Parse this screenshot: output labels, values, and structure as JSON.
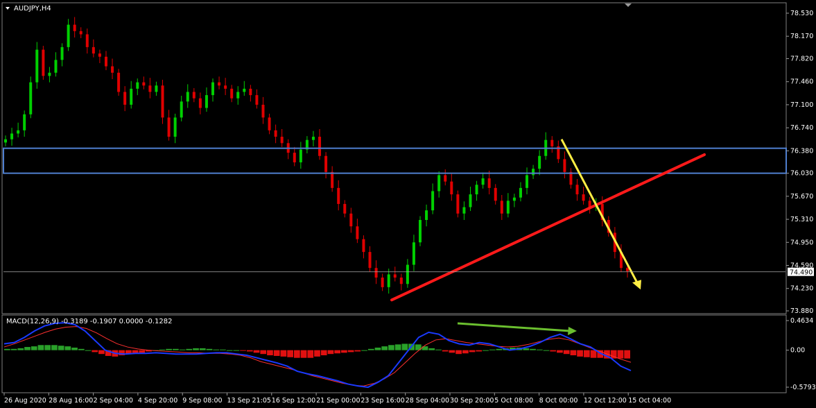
{
  "symbol_label": "AUDJPY,H4",
  "chart_data": [
    {
      "type": "candlestick",
      "title": "AUDJPY,H4",
      "y_ticks": [
        "78.530",
        "78.170",
        "77.820",
        "77.460",
        "77.100",
        "76.740",
        "76.380",
        "76.030",
        "75.670",
        "75.310",
        "74.950",
        "74.590",
        "74.230",
        "73.880"
      ],
      "ylim": [
        73.88,
        78.53
      ],
      "current_price": "74.490",
      "x_labels": [
        "26 Aug 2020",
        "28 Aug 16:00",
        "2 Sep 04:00",
        "4 Sep 20:00",
        "9 Sep 08:00",
        "13 Sep 21:05",
        "16 Sep 12:00",
        "21 Sep 00:00",
        "23 Sep 16:00",
        "28 Sep 04:00",
        "30 Sep 20:00",
        "5 Oct 08:00",
        "8 Oct 00:00",
        "12 Oct 12:00",
        "15 Oct 04:00"
      ],
      "closes": [
        76.56,
        76.65,
        76.7,
        76.95,
        77.45,
        77.96,
        77.55,
        77.6,
        77.8,
        78.0,
        78.35,
        78.25,
        78.2,
        78.0,
        77.9,
        77.85,
        77.7,
        77.6,
        77.3,
        77.1,
        77.35,
        77.45,
        77.4,
        77.3,
        77.4,
        76.9,
        76.6,
        76.9,
        77.15,
        77.3,
        77.2,
        77.05,
        77.25,
        77.45,
        77.4,
        77.35,
        77.2,
        77.3,
        77.35,
        77.25,
        77.1,
        76.9,
        76.7,
        76.6,
        76.5,
        76.35,
        76.2,
        76.4,
        76.55,
        76.6,
        76.3,
        76.05,
        75.8,
        75.55,
        75.4,
        75.2,
        75.0,
        74.8,
        74.55,
        74.4,
        74.25,
        74.45,
        74.4,
        74.3,
        74.6,
        74.95,
        75.3,
        75.45,
        75.75,
        76.0,
        75.9,
        75.7,
        75.4,
        75.5,
        75.7,
        75.85,
        75.95,
        75.8,
        75.6,
        75.4,
        75.6,
        75.65,
        75.8,
        76.0,
        76.1,
        76.3,
        76.55,
        76.45,
        76.25,
        76.05,
        75.85,
        75.7,
        75.6,
        75.5,
        75.55,
        75.3,
        75.1,
        74.8,
        74.55,
        74.5
      ],
      "support_zone": [
        76.03,
        76.42
      ],
      "trendline_red": [
        [
          74.05
        ],
        [
          76.32
        ]
      ],
      "trendline_yellow": [
        [
          76.56
        ],
        [
          74.3
        ]
      ]
    },
    {
      "type": "histogram+line",
      "title": "MACD(12,26,9) -0.3189 -0.1907 0.0000 -0.1282",
      "y_ticks": [
        "0.4634",
        "0.00",
        "-0.5793"
      ],
      "ylim": [
        -0.5793,
        0.4634
      ],
      "histogram": [
        0.02,
        0.02,
        0.03,
        0.05,
        0.06,
        0.08,
        0.08,
        0.08,
        0.07,
        0.06,
        0.04,
        0.02,
        0.0,
        -0.03,
        -0.06,
        -0.09,
        -0.1,
        -0.08,
        -0.06,
        -0.05,
        -0.04,
        -0.02,
        0.0,
        0.01,
        0.02,
        0.02,
        0.01,
        0.02,
        0.03,
        0.03,
        0.02,
        0.01,
        0.01,
        0.0,
        0.0,
        -0.01,
        -0.02,
        -0.04,
        -0.06,
        -0.08,
        -0.09,
        -0.1,
        -0.11,
        -0.12,
        -0.12,
        -0.12,
        -0.1,
        -0.08,
        -0.06,
        -0.05,
        -0.04,
        -0.03,
        -0.02,
        0.0,
        0.02,
        0.04,
        0.06,
        0.08,
        0.09,
        0.1,
        0.1,
        0.09,
        0.06,
        0.03,
        0.01,
        -0.02,
        -0.04,
        -0.06,
        -0.05,
        -0.03,
        -0.02,
        0.0,
        0.01,
        0.02,
        0.03,
        0.04,
        0.04,
        0.03,
        0.02,
        0.01,
        0.0,
        -0.02,
        -0.04,
        -0.06,
        -0.08,
        -0.1,
        -0.11,
        -0.12,
        -0.12,
        -0.13,
        -0.13,
        -0.13,
        -0.13
      ],
      "macd_line": [
        0.1,
        0.12,
        0.2,
        0.3,
        0.38,
        0.42,
        0.43,
        0.4,
        0.3,
        0.15,
        0.0,
        -0.05,
        -0.06,
        -0.05,
        -0.05,
        -0.04,
        -0.05,
        -0.06,
        -0.06,
        -0.06,
        -0.05,
        -0.04,
        -0.04,
        -0.06,
        -0.08,
        -0.12,
        -0.16,
        -0.2,
        -0.25,
        -0.33,
        -0.37,
        -0.4,
        -0.44,
        -0.48,
        -0.53,
        -0.56,
        -0.58,
        -0.5,
        -0.4,
        -0.2,
        0.0,
        0.2,
        0.28,
        0.25,
        0.15,
        0.1,
        0.08,
        0.12,
        0.1,
        0.05,
        0.0,
        0.02,
        0.06,
        0.12,
        0.2,
        0.25,
        0.18,
        0.1,
        0.05,
        -0.05,
        -0.12,
        -0.25,
        -0.32
      ],
      "signal_line": [
        0.05,
        0.1,
        0.16,
        0.22,
        0.28,
        0.33,
        0.36,
        0.37,
        0.34,
        0.27,
        0.18,
        0.1,
        0.05,
        0.02,
        0.0,
        -0.01,
        -0.02,
        -0.03,
        -0.04,
        -0.04,
        -0.05,
        -0.05,
        -0.06,
        -0.08,
        -0.12,
        -0.18,
        -0.22,
        -0.26,
        -0.3,
        -0.35,
        -0.4,
        -0.44,
        -0.48,
        -0.52,
        -0.55,
        -0.56,
        -0.52,
        -0.45,
        -0.35,
        -0.2,
        -0.05,
        0.08,
        0.16,
        0.18,
        0.15,
        0.12,
        0.1,
        0.08,
        0.06,
        0.05,
        0.06,
        0.09,
        0.13,
        0.17,
        0.19,
        0.16,
        0.1,
        0.04,
        -0.02,
        -0.08,
        -0.14,
        -0.19
      ],
      "divergence_arrow": "green"
    }
  ],
  "colors": {
    "bull": "#00d000",
    "bear": "#e00000",
    "zone": "#4f7fcf",
    "trend_red": "#ff1a1a",
    "trend_yellow": "#ffee44",
    "macd_line": "#1a3aff",
    "signal_line": "#ff3030",
    "divergence": "#6bbf2f",
    "grid": "#808080"
  }
}
